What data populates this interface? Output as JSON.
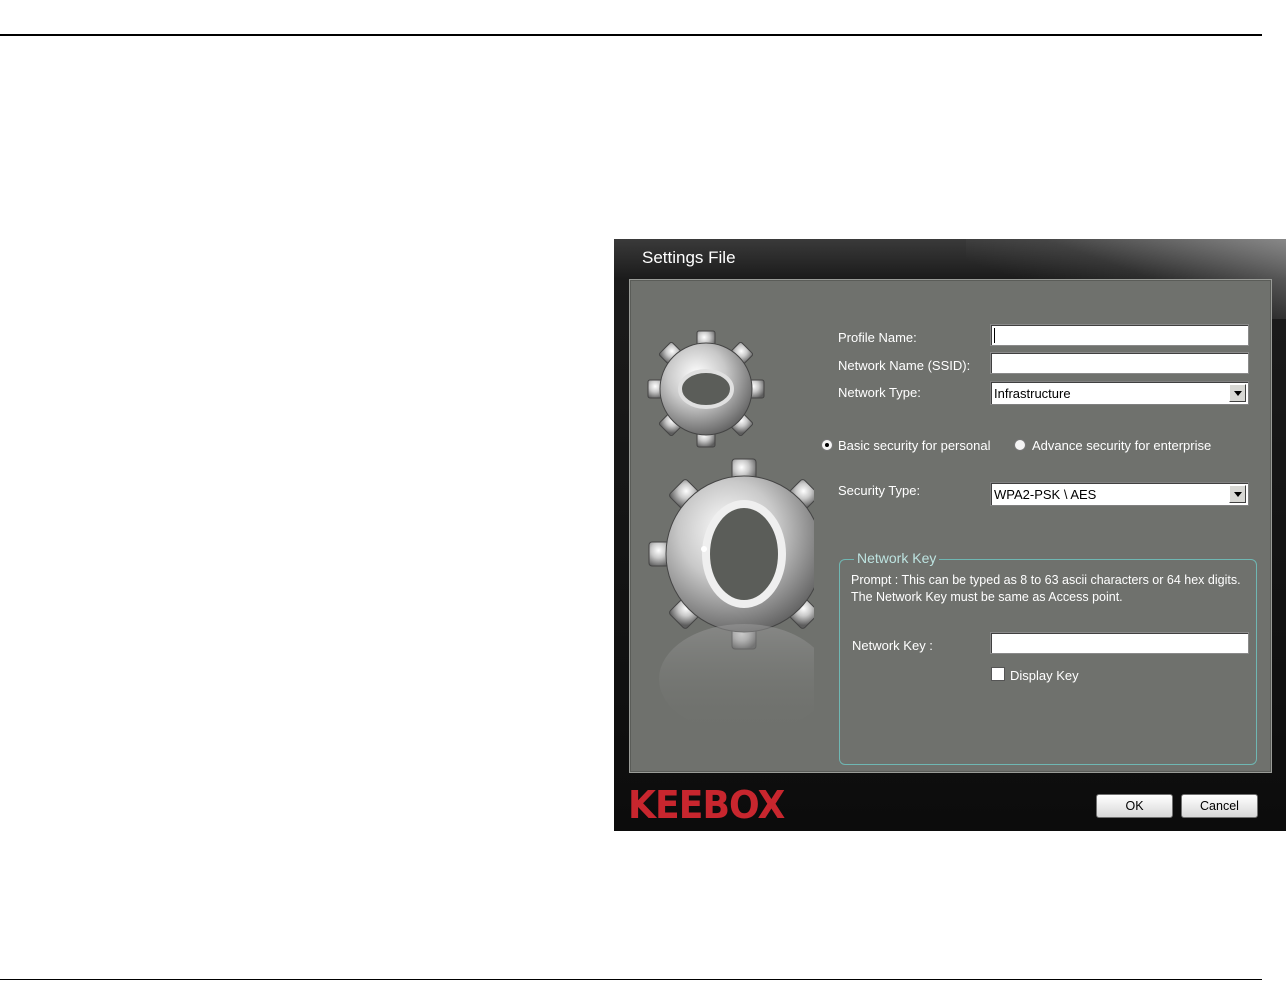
{
  "dialog": {
    "title": "Settings File",
    "profile_name_label": "Profile Name:",
    "profile_name_value": "",
    "ssid_label": "Network Name (SSID):",
    "ssid_value": "",
    "network_type_label": "Network Type:",
    "network_type_value": "Infrastructure",
    "security_modes": [
      {
        "label": "Basic security for personal",
        "selected": true
      },
      {
        "label": "Advance security for enterprise",
        "selected": false
      }
    ],
    "security_type_label": "Security Type:",
    "security_type_value": "WPA2-PSK \\ AES",
    "network_key_group": {
      "legend": "Network Key",
      "prompt": "Prompt : This can be typed as 8 to 63 ascii characters or  64 hex digits. The Network Key must be same as Access point.",
      "key_label": "Network Key :",
      "key_value": "",
      "display_key_label": "Display Key",
      "display_key_checked": false
    },
    "brand": "KEEBOX",
    "ok_label": "OK",
    "cancel_label": "Cancel"
  },
  "colors": {
    "panel": "#6f716d",
    "group_border": "#6fb7b3",
    "brand_red": "#c8262e"
  },
  "icons": [
    "gears-icon"
  ]
}
